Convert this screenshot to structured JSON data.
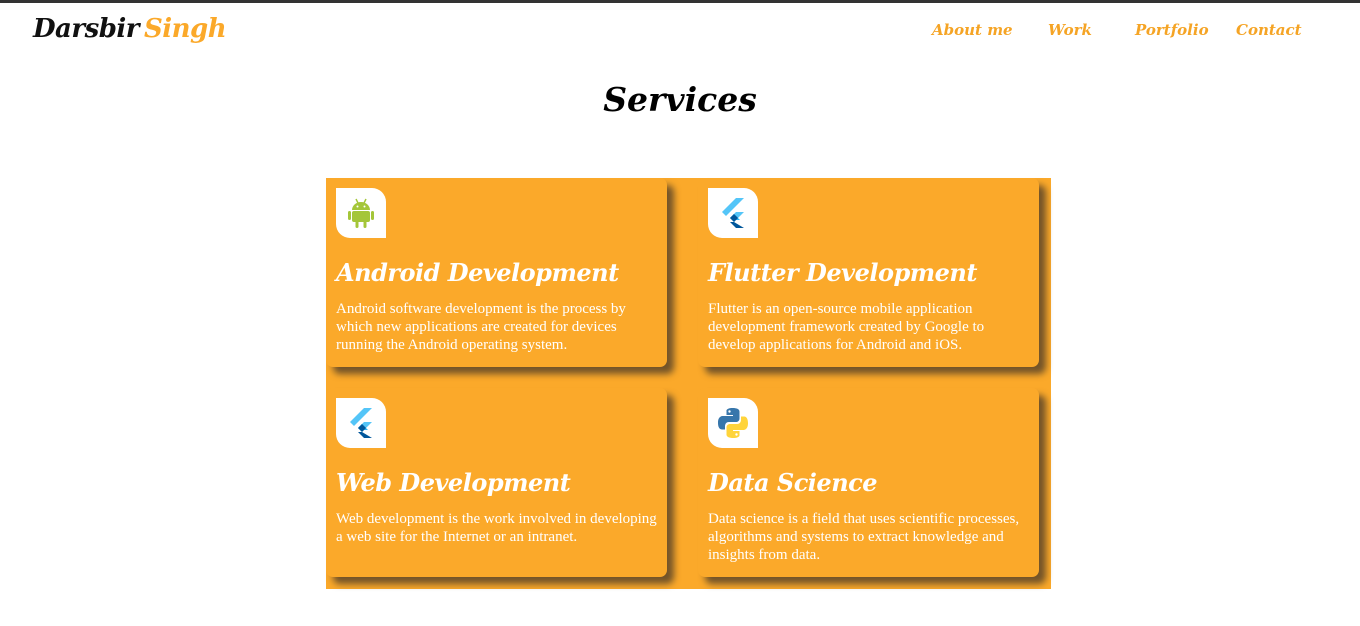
{
  "header": {
    "logo_first": "Darsbir",
    "logo_last": "Singh",
    "nav": [
      {
        "label": "About me"
      },
      {
        "label": "Work"
      },
      {
        "label": "Portfolio"
      },
      {
        "label": "Contact"
      }
    ]
  },
  "services": {
    "title": "Services",
    "cards": [
      {
        "icon": "android-icon",
        "title": "Android Development",
        "description": "Android software development is the process by which new applications are created for devices running the Android operating system."
      },
      {
        "icon": "flutter-icon",
        "title": "Flutter Development",
        "description": "Flutter is an open-source mobile application development framework created by Google to develop applications for Android and iOS."
      },
      {
        "icon": "flutter-icon",
        "title": "Web Development",
        "description": "Web development is the work involved in developing a web site for the Internet or an intranet."
      },
      {
        "icon": "python-icon",
        "title": "Data Science",
        "description": "Data science is a field that uses scientific processes, algorithms and systems to extract knowledge and insights from data."
      }
    ]
  },
  "colors": {
    "accent": "#fba92a",
    "nav_text": "#f5a425",
    "title_text": "#000000",
    "card_text": "#ffffff"
  }
}
